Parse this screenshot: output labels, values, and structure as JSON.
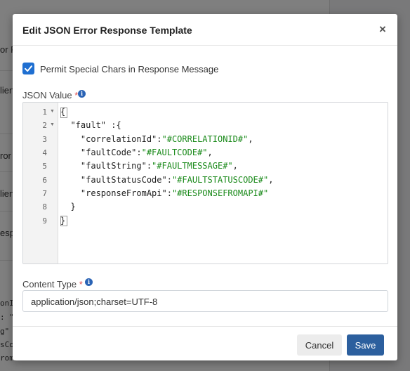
{
  "background": {
    "fragments": [
      "or P",
      "lien",
      "ror",
      "lien",
      "esp"
    ],
    "code_fragments": [
      "onIc",
      ": \"#",
      "g\"",
      "sCo",
      "rom/"
    ]
  },
  "modal": {
    "title": "Edit JSON Error Response Template",
    "close_glyph": "×",
    "checkbox_label": "Permit Special Chars in Response Message",
    "checkbox_checked": true,
    "json_label": "JSON Value",
    "content_type_label": "Content Type",
    "required_mark": "*",
    "info_glyph": "i",
    "editor": {
      "line_numbers": [
        "1",
        "2",
        "3",
        "4",
        "5",
        "6",
        "7",
        "8",
        "9"
      ],
      "fold_markers": [
        "▼",
        "▼"
      ],
      "lines": [
        {
          "plain": "{",
          "str": "",
          "tail": ""
        },
        {
          "plain": "  \"fault\" :{",
          "str": "",
          "tail": ""
        },
        {
          "plain": "    \"correlationId\":",
          "str": "\"#CORRELATIONID#\"",
          "tail": ","
        },
        {
          "plain": "    \"faultCode\":",
          "str": "\"#FAULTCODE#\"",
          "tail": ","
        },
        {
          "plain": "    \"faultString\":",
          "str": "\"#FAULTMESSAGE#\"",
          "tail": ","
        },
        {
          "plain": "    \"faultStatusCode\":",
          "str": "\"#FAULTSTATUSCODE#\"",
          "tail": ","
        },
        {
          "plain": "    \"responseFromApi\":",
          "str": "\"#RESPONSEFROMAPI#\"",
          "tail": ""
        },
        {
          "plain": "  }",
          "str": "",
          "tail": ""
        },
        {
          "plain": "}",
          "str": "",
          "tail": ""
        }
      ]
    },
    "content_type_value": "application/json;charset=UTF-8",
    "cancel_label": "Cancel",
    "save_label": "Save"
  },
  "colors": {
    "primary": "#2c5f9e",
    "checkbox": "#1f6fd1",
    "string": "#1a8a1a",
    "required": "#e05252"
  }
}
